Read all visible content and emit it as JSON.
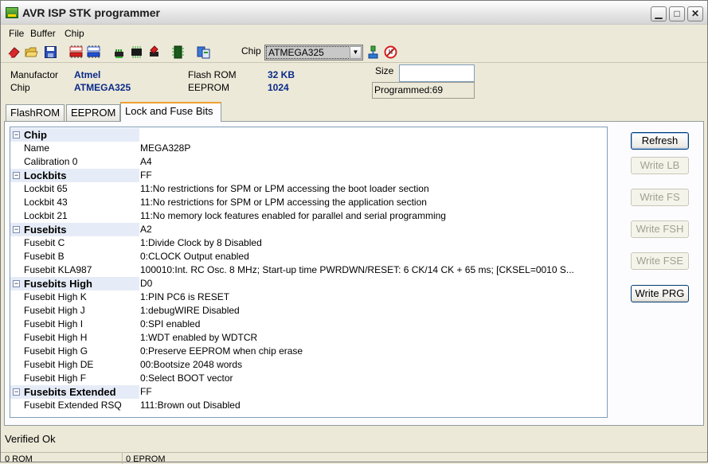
{
  "window": {
    "title": "AVR ISP STK programmer"
  },
  "menu": {
    "file": "File",
    "buffer": "Buffer",
    "chip": "Chip"
  },
  "toolbar": {
    "chip_label": "Chip",
    "chip_selected": "ATMEGA325",
    "icons": [
      "eraser-icon",
      "open-folder-icon",
      "save-icon",
      "read-flash-icon",
      "write-flash-icon",
      "read-chip-icon",
      "chip-icon",
      "chip-erase-icon",
      "verify-icon",
      "copy-icon",
      "connect-icon",
      "stop-icon"
    ]
  },
  "info": {
    "manufactor_label": "Manufactor",
    "manufactor_value": "Atmel",
    "chip_label": "Chip",
    "chip_value": "ATMEGA325",
    "flash_label": "Flash ROM",
    "flash_value": "32 KB",
    "eeprom_label": "EEPROM",
    "eeprom_value": "1024",
    "size_label": "Size",
    "size_value": "",
    "programmed": "Programmed:69"
  },
  "tabs": [
    "FlashROM",
    "EEPROM",
    "Lock and Fuse Bits"
  ],
  "grid": {
    "rows": [
      {
        "type": "cat",
        "name": "Chip",
        "value": ""
      },
      {
        "type": "item",
        "name": "Name",
        "value": "MEGA328P"
      },
      {
        "type": "item",
        "name": "Calibration 0",
        "value": "A4"
      },
      {
        "type": "cat",
        "name": "Lockbits",
        "value": "FF"
      },
      {
        "type": "item",
        "name": "Lockbit 65",
        "value": "11:No restrictions for SPM or LPM accessing the boot loader section"
      },
      {
        "type": "item",
        "name": "Lockbit 43",
        "value": "11:No restrictions for SPM or LPM accessing the application section"
      },
      {
        "type": "item",
        "name": "Lockbit 21",
        "value": "11:No memory lock features enabled for parallel and serial programming"
      },
      {
        "type": "cat",
        "name": "Fusebits",
        "value": "A2"
      },
      {
        "type": "item",
        "name": "Fusebit C",
        "value": "1:Divide Clock by 8 Disabled"
      },
      {
        "type": "item",
        "name": "Fusebit B",
        "value": "0:CLOCK Output enabled"
      },
      {
        "type": "item",
        "name": "Fusebit KLA987",
        "value": "100010:Int. RC Osc. 8 MHz; Start-up time PWRDWN/RESET: 6 CK/14 CK + 65 ms; [CKSEL=0010 S..."
      },
      {
        "type": "cat",
        "name": "Fusebits High",
        "value": "D0"
      },
      {
        "type": "item",
        "name": "Fusebit High K",
        "value": "1:PIN PC6 is RESET"
      },
      {
        "type": "item",
        "name": "Fusebit High J",
        "value": "1:debugWIRE Disabled"
      },
      {
        "type": "item",
        "name": "Fusebit High I",
        "value": "0:SPI enabled"
      },
      {
        "type": "item",
        "name": "Fusebit High H",
        "value": "1:WDT enabled by WDTCR"
      },
      {
        "type": "item",
        "name": "Fusebit High G",
        "value": "0:Preserve EEPROM when chip erase"
      },
      {
        "type": "item",
        "name": "Fusebit High DE",
        "value": "00:Bootsize 2048 words"
      },
      {
        "type": "item",
        "name": "Fusebit High F",
        "value": "0:Select BOOT vector"
      },
      {
        "type": "cat",
        "name": "Fusebits Extended",
        "value": "FF"
      },
      {
        "type": "item",
        "name": "Fusebit Extended RSQ",
        "value": "111:Brown out Disabled"
      }
    ]
  },
  "buttons": {
    "refresh": "Refresh",
    "write_lb": "Write LB",
    "write_fs": "Write FS",
    "write_fsh": "Write FSH",
    "write_fse": "Write FSE",
    "write_prg": "Write PRG"
  },
  "status": {
    "message": "Verified Ok",
    "rom": "0 ROM",
    "eprom": "0 EPROM"
  }
}
